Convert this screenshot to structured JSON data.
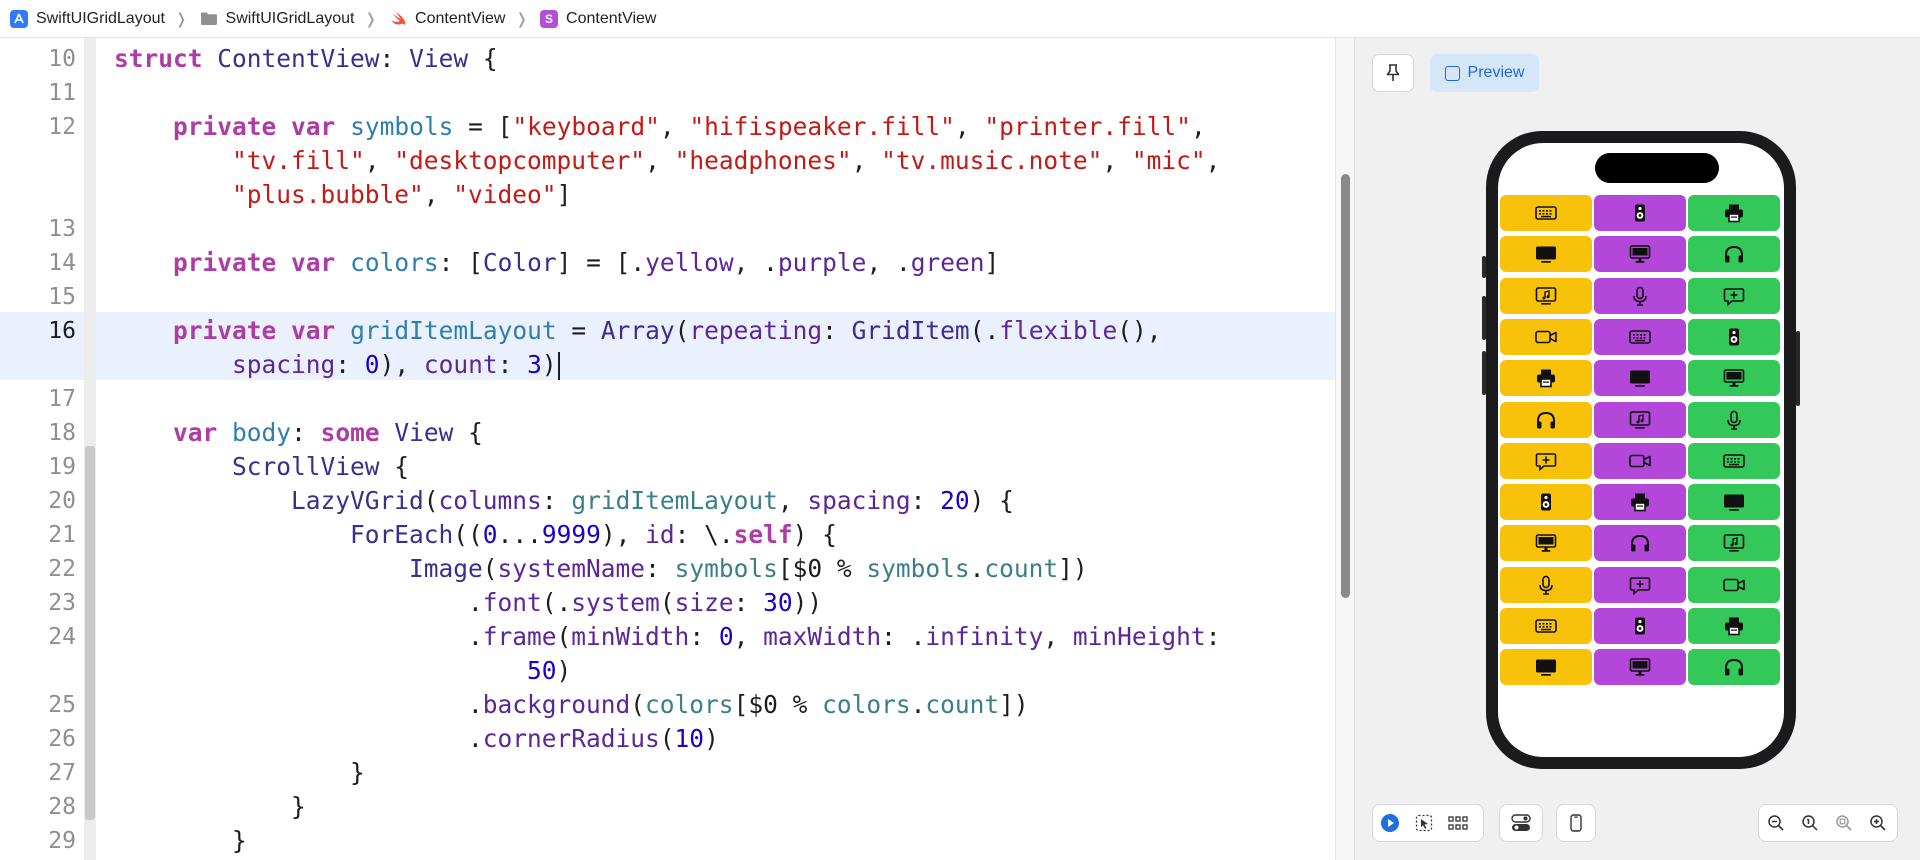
{
  "breadcrumb": {
    "items": [
      {
        "label": "SwiftUIGridLayout",
        "icon": "app-project-icon"
      },
      {
        "label": "SwiftUIGridLayout",
        "icon": "folder-icon"
      },
      {
        "label": "ContentView",
        "icon": "swift-file-icon"
      },
      {
        "label": "ContentView",
        "icon": "struct-symbol-icon"
      }
    ],
    "struct_badge": "S"
  },
  "editor": {
    "current_line": 16,
    "line_numbers": [
      "10",
      "11",
      "12",
      "13",
      "14",
      "15",
      "16",
      "17",
      "18",
      "19",
      "20",
      "21",
      "22",
      "23",
      "24",
      "25",
      "26",
      "27",
      "28",
      "29"
    ]
  },
  "canvas": {
    "preview_label": "Preview",
    "colors": {
      "yellow": "#f9c20a",
      "purple": "#b347d9",
      "green": "#34c759"
    },
    "grid_icons": [
      "keyboard",
      "hifispeaker.fill",
      "printer.fill",
      "tv.fill",
      "desktopcomputer",
      "headphones",
      "tv.music.note",
      "mic",
      "plus.bubble",
      "video"
    ],
    "visible_cells": 36,
    "columns": 3
  }
}
